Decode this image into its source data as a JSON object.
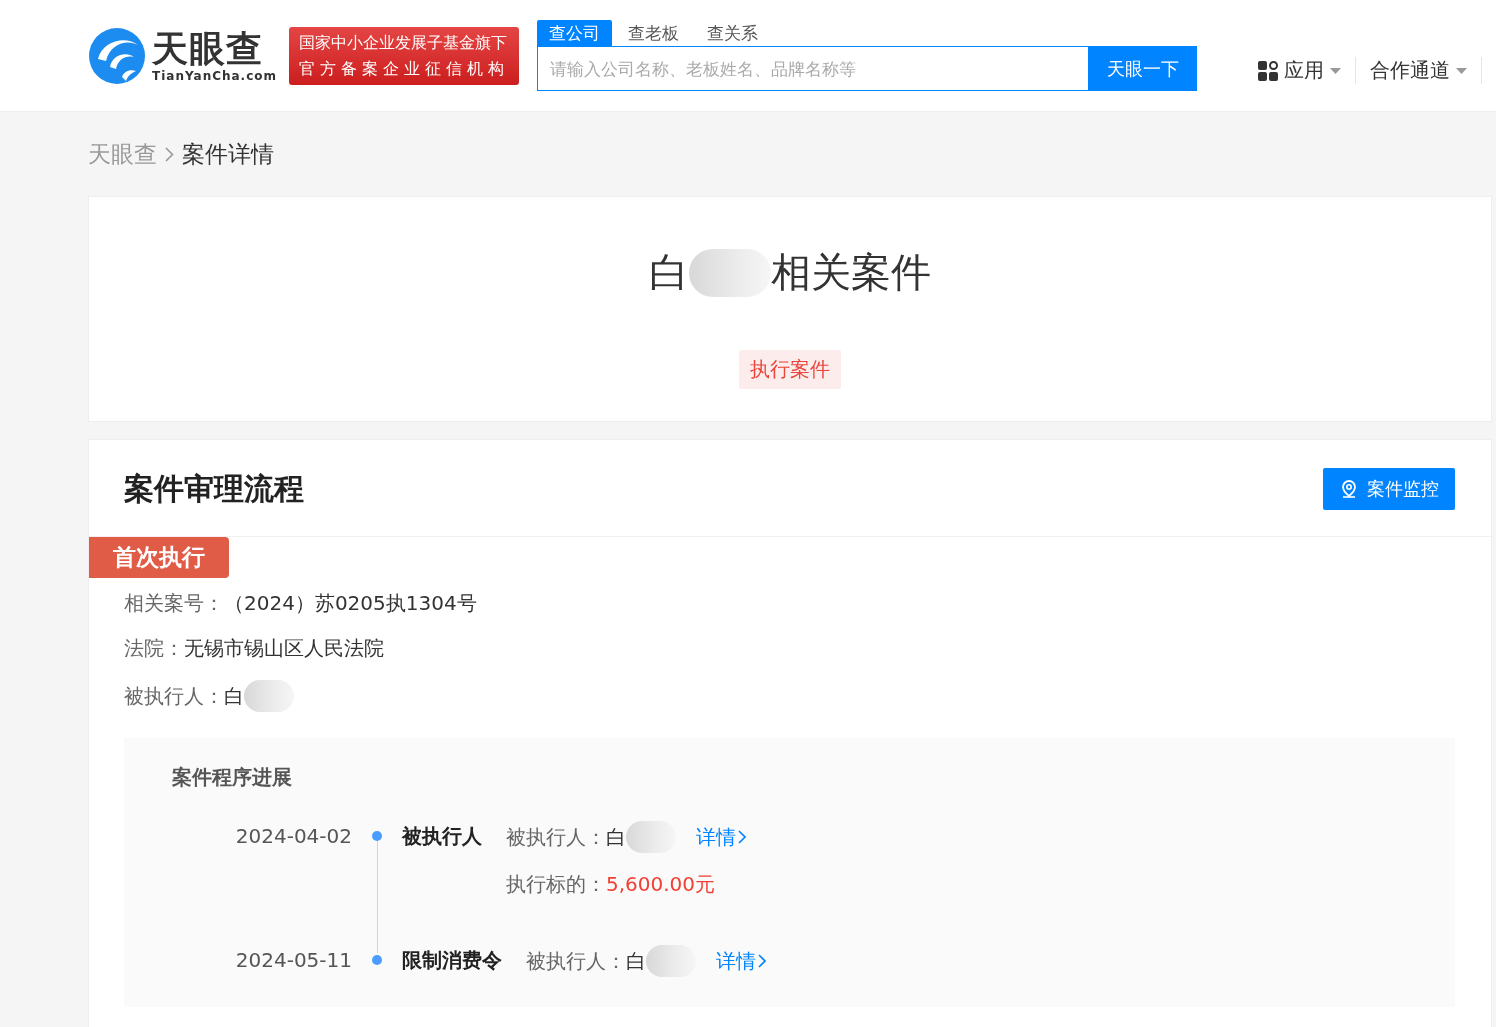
{
  "header": {
    "logo": {
      "name": "天眼查",
      "domain": "TianYanCha.com"
    },
    "badge_lines": [
      "国家中小企业发展子基金旗下",
      "官方备案企业征信机构"
    ],
    "search_tabs": [
      {
        "label": "查公司",
        "selected": true
      },
      {
        "label": "查老板",
        "selected": false
      },
      {
        "label": "查关系",
        "selected": false
      }
    ],
    "search": {
      "placeholder": "请输入公司名称、老板姓名、品牌名称等",
      "button": "天眼一下"
    },
    "nav": [
      {
        "label": "应用",
        "kind": "apps"
      },
      {
        "label": "合作通道",
        "kind": "plain"
      }
    ]
  },
  "breadcrumb": [
    "天眼查",
    "案件详情"
  ],
  "case": {
    "title_prefix": "白",
    "title_suffix": "相关案件",
    "tag": "执行案件"
  },
  "process": {
    "title": "案件审理流程",
    "monitor_button": "案件监控",
    "stage": "首次执行",
    "fields": [
      {
        "label": "相关案号：",
        "value": "（2024）苏0205执1304号",
        "blurred": false
      },
      {
        "label": "法院：",
        "value": "无锡市锡山区人民法院",
        "blurred": false
      },
      {
        "label": "被执行人：",
        "value": "白",
        "blurred": true
      }
    ],
    "progress": {
      "title": "案件程序进展",
      "events": [
        {
          "date": "2024-04-02",
          "type": "被执行人",
          "lines": [
            {
              "label": "被执行人：",
              "value": "白",
              "blurred": true,
              "highlight": false,
              "link": "详情"
            },
            {
              "label": "执行标的：",
              "value": "5,600.00元",
              "blurred": false,
              "highlight": true
            }
          ]
        },
        {
          "date": "2024-05-11",
          "type": "限制消费令",
          "lines": [
            {
              "label": "被执行人：",
              "value": "白",
              "blurred": true,
              "highlight": false,
              "link": "详情"
            }
          ]
        }
      ]
    }
  }
}
